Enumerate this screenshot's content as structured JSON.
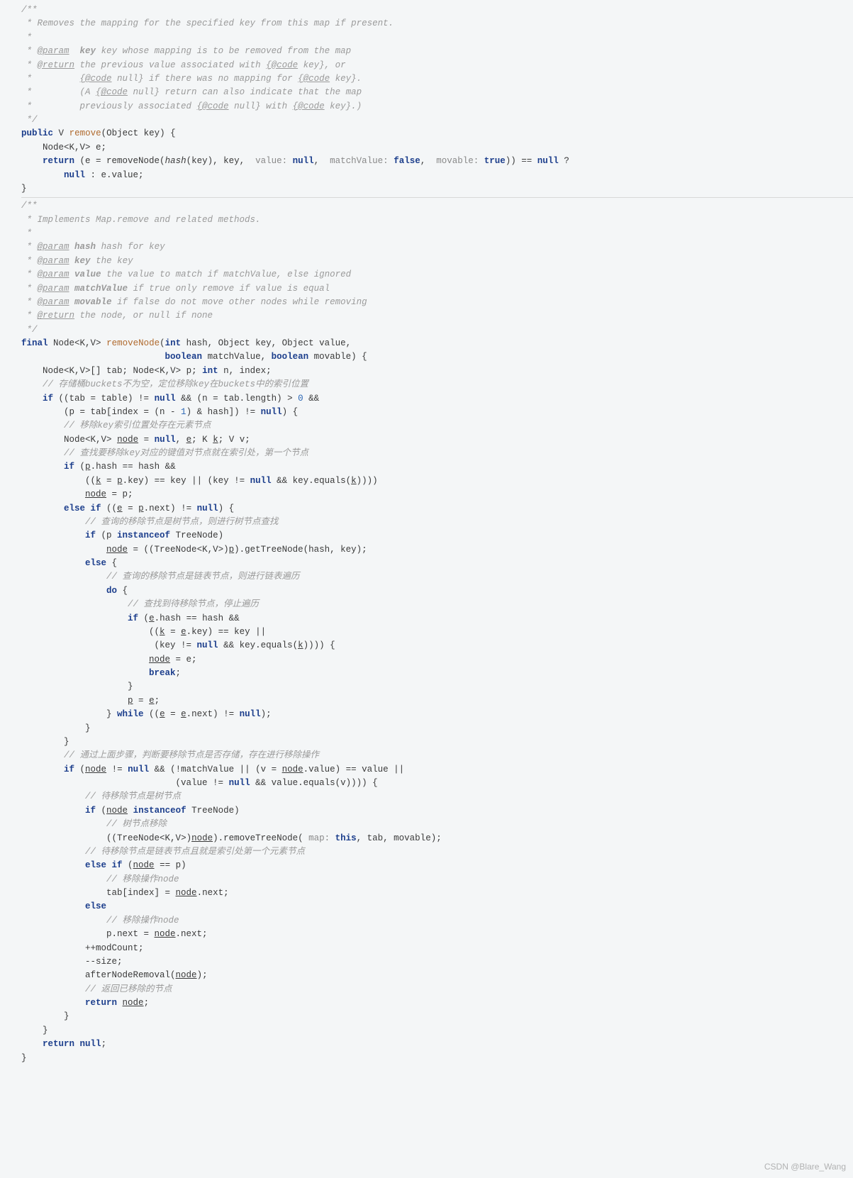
{
  "watermark": "CSDN @Blare_Wang",
  "code": {
    "block1": {
      "c1": "/**",
      "c2": " * Removes the mapping for the specified key from this map if present.",
      "c3": " *",
      "c4a": " * ",
      "c4_tag": "@param",
      "c4b": "  ",
      "c4_var": "key",
      "c4c": " key whose mapping is to be removed from the map",
      "c5a": " * ",
      "c5_tag": "@return",
      "c5b": " the previous value associated with ",
      "c5_code1": "{@code",
      "c5c": " key}, or",
      "c6a": " *         ",
      "c6_code1": "{@code",
      "c6b": " null} if there was no mapping for ",
      "c6_code2": "{@code",
      "c6c": " key}.",
      "c7a": " *         (A ",
      "c7_code1": "{@code",
      "c7b": " null} return can also indicate that the map",
      "c8a": " *         previously associated ",
      "c8_code1": "{@code",
      "c8b": " null} with ",
      "c8_code2": "{@code",
      "c8c": " key}.)",
      "c9": " */",
      "l1_kw_public": "public",
      "l1_type": "V",
      "l1_method": "remove",
      "l1_params": "(Object key) {",
      "l2a": "    Node<",
      "l2_gen": "K,V",
      "l2b": "> e;",
      "l3_kw": "return",
      "l3a": " (e = removeNode(",
      "l3_hash": "hash",
      "l3b": "(key), key,  ",
      "l3_hint1": "value:",
      "l3c": " ",
      "l3_null1": "null",
      "l3d": ",  ",
      "l3_hint2": "matchValue:",
      "l3e": " ",
      "l3_false": "false",
      "l3f": ",  ",
      "l3_hint3": "movable:",
      "l3g": " ",
      "l3_true": "true",
      "l3h": ")) == ",
      "l3_null2": "null",
      "l3i": " ?",
      "l4a": "        ",
      "l4_null": "null",
      "l4b": " : e.value;",
      "l5": "}"
    },
    "block2": {
      "c1": "/**",
      "c2": " * Implements Map.remove and related methods.",
      "c3": " *",
      "c4a": " * ",
      "c4_tag": "@param",
      "c4b": " ",
      "c4_var": "hash",
      "c4c": " hash for key",
      "c5a": " * ",
      "c5_tag": "@param",
      "c5b": " ",
      "c5_var": "key",
      "c5c": " the key",
      "c6a": " * ",
      "c6_tag": "@param",
      "c6b": " ",
      "c6_var": "value",
      "c6c": " the value to match if matchValue, else ignored",
      "c7a": " * ",
      "c7_tag": "@param",
      "c7b": " ",
      "c7_var": "matchValue",
      "c7c": " if true only remove if value is equal",
      "c8a": " * ",
      "c8_tag": "@param",
      "c8b": " ",
      "c8_var": "movable",
      "c8c": " if false do not move other nodes while removing",
      "c9a": " * ",
      "c9_tag": "@return",
      "c9b": " the node, or null if none",
      "c10": " */",
      "l1_kw": "final",
      "l1a": " Node<",
      "l1_gen": "K,V",
      "l1b": "> ",
      "l1_method": "removeNode",
      "l1c": "(",
      "l1_kw2": "int",
      "l1d": " hash, Object key, Object value,",
      "l2a": "                           ",
      "l2_kw1": "boolean",
      "l2b": " matchValue, ",
      "l2_kw2": "boolean",
      "l2c": " movable) {",
      "l3a": "    Node<",
      "l3_gen": "K,V",
      "l3b": ">[] tab; Node<",
      "l3_gen2": "K,V",
      "l3c": "> p; ",
      "l3_kw": "int",
      "l3d": " n, index;",
      "l4": "    // 存储桶buckets不为空，定位移除key在buckets中的索引位置",
      "l5_kw": "if",
      "l5a": " ((tab = table) != ",
      "l5_null": "null",
      "l5b": " && (n = tab.length) > ",
      "l5_num": "0",
      "l5c": " &&",
      "l6a": "        (p = tab[index = (n - ",
      "l6_num": "1",
      "l6b": ") & hash]) != ",
      "l6_null": "null",
      "l6c": ") {",
      "l7": "        // 移除key索引位置处存在元素节点",
      "l8a": "        Node<",
      "l8_gen": "K,V",
      "l8b": "> ",
      "l8_node": "node",
      "l8c": " = ",
      "l8_null": "null",
      "l8d": ", ",
      "l8_e": "e",
      "l8e2": "; ",
      "l8_K": "K",
      "l8f": " ",
      "l8_k": "k",
      "l8g": "; ",
      "l8_V": "V",
      "l8h": " v;",
      "l9": "        // 查找要移除key对应的键值对节点就在索引处，第一个节点",
      "l10_kw": "if",
      "l10a": " (",
      "l10_p": "p",
      "l10b": ".hash == hash &&",
      "l11a": "            ((",
      "l11_k": "k",
      "l11b": " = ",
      "l11_p": "p",
      "l11c": ".key) == key || (key != ",
      "l11_null": "null",
      "l11d": " && key.equals(",
      "l11_k2": "k",
      "l11e": "))))",
      "l12a": "            ",
      "l12_node": "node",
      "l12b": " = p;",
      "l13_kw": "else if",
      "l13a": " ((",
      "l13_e": "e",
      "l13b": " = ",
      "l13_p": "p",
      "l13c": ".next) != ",
      "l13_null": "null",
      "l13d": ") {",
      "l14": "            // 查询的移除节点是树节点，则进行树节点查找",
      "l15_kw": "if",
      "l15a": " (p ",
      "l15_kw2": "instanceof",
      "l15b": " TreeNode)",
      "l16a": "                ",
      "l16_node": "node",
      "l16b": " = ((TreeNode<",
      "l16_gen": "K,V",
      "l16c": ">)",
      "l16_p": "p",
      "l16d": ").getTreeNode(hash, key);",
      "l17_kw": "else",
      "l17a": " {",
      "l18": "                // 查询的移除节点是链表节点，则进行链表遍历",
      "l19_kw": "do",
      "l19a": " {",
      "l20": "                    // 查找到待移除节点，停止遍历",
      "l21_kw": "if",
      "l21a": " (",
      "l21_e": "e",
      "l21b": ".hash == hash &&",
      "l22a": "                        ((",
      "l22_k": "k",
      "l22b": " = ",
      "l22_e": "e",
      "l22c": ".key) == key ||",
      "l23a": "                         (key != ",
      "l23_null": "null",
      "l23b": " && key.equals(",
      "l23_k": "k",
      "l23c": ")))) {",
      "l24a": "                        ",
      "l24_node": "node",
      "l24b": " = e;",
      "l25_kw": "break",
      "l25a": ";",
      "l26": "                    }",
      "l27a": "                    ",
      "l27_p": "p",
      "l27b": " = ",
      "l27_e": "e",
      "l27c": ";",
      "l28a": "                } ",
      "l28_kw": "while",
      "l28b": " ((",
      "l28_e": "e",
      "l28c": " = ",
      "l28_e2": "e",
      "l28d": ".next) != ",
      "l28_null": "null",
      "l28e": ");",
      "l29": "            }",
      "l30": "        }",
      "l31": "        // 通过上面步骤，判断要移除节点是否存储，存在进行移除操作",
      "l32_kw": "if",
      "l32a": " (",
      "l32_node": "node",
      "l32b": " != ",
      "l32_null": "null",
      "l32c": " && (!matchValue || (v = ",
      "l32_node2": "node",
      "l32d": ".value) == value ||",
      "l33a": "                             (value != ",
      "l33_null": "null",
      "l33b": " && value.equals(v)))) {",
      "l34": "            // 待移除节点是树节点",
      "l35_kw": "if",
      "l35a": " (",
      "l35_node": "node",
      "l35b": " ",
      "l35_kw2": "instanceof",
      "l35c": " TreeNode)",
      "l36": "                // 树节点移除",
      "l37a": "                ((TreeNode<",
      "l37_gen": "K,V",
      "l37b": ">)",
      "l37_node": "node",
      "l37c": ").removeTreeNode( ",
      "l37_hint": "map:",
      "l37d": " ",
      "l37_this": "this",
      "l37e": ", tab, movable);",
      "l38": "            // 待移除节点是链表节点且就是索引处第一个元素节点",
      "l39_kw": "else if",
      "l39a": " (",
      "l39_node": "node",
      "l39b": " == p)",
      "l40": "                // 移除操作node",
      "l41a": "                tab[index] = ",
      "l41_node": "node",
      "l41b": ".next;",
      "l42_kw": "else",
      "l43": "                // 移除操作node",
      "l44a": "                p.next = ",
      "l44_node": "node",
      "l44b": ".next;",
      "l45": "            ++modCount;",
      "l46": "            --size;",
      "l47a": "            afterNodeRemoval(",
      "l47_node": "node",
      "l47b": ");",
      "l48": "            // 返回已移除的节点",
      "l49_kw": "return",
      "l49a": " ",
      "l49_node": "node",
      "l49b": ";",
      "l50": "        }",
      "l51": "    }",
      "l52_kw": "return",
      "l52a": " ",
      "l52_null": "null",
      "l52b": ";",
      "l53": "}"
    }
  }
}
